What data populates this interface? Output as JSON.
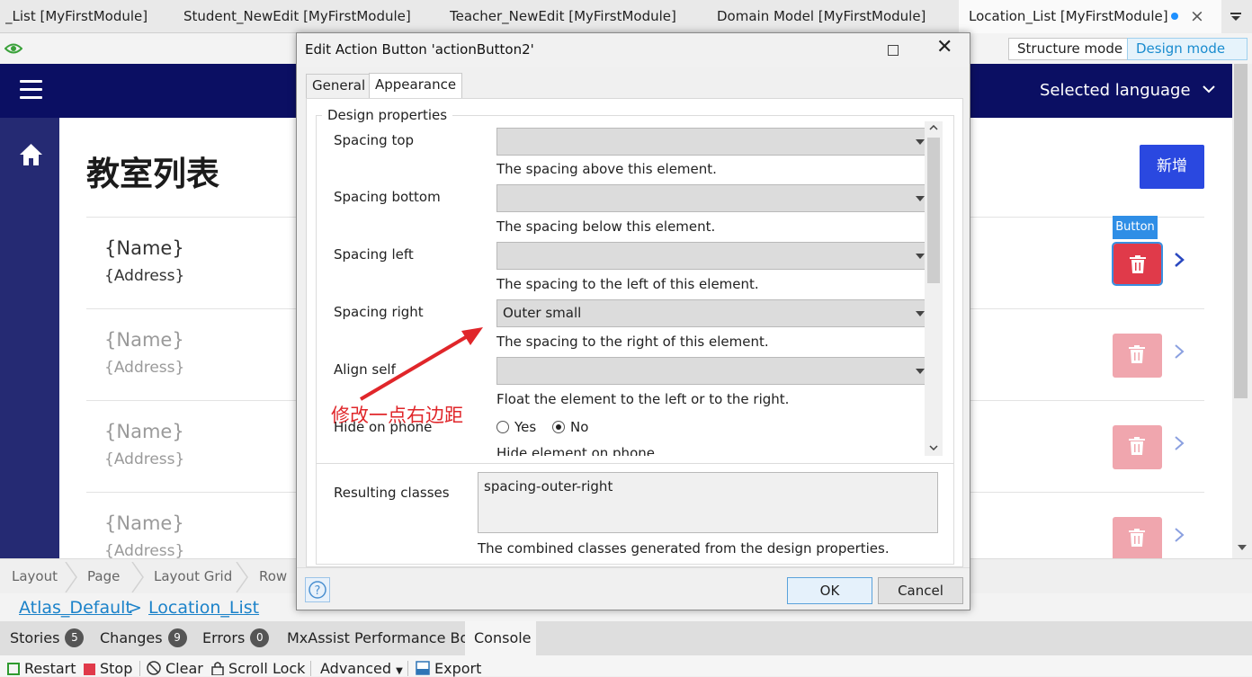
{
  "doc_tabs": [
    {
      "label": "_List [MyFirstModule]"
    },
    {
      "label": "Student_NewEdit [MyFirstModule]"
    },
    {
      "label": "Teacher_NewEdit [MyFirstModule]"
    },
    {
      "label": "Domain Model [MyFirstModule]"
    },
    {
      "label": "Location_List [MyFirstModule]",
      "active": true
    }
  ],
  "toolbar": {
    "structure_mode": "Structure mode",
    "design_mode": "Design mode",
    "active_mode": "Design mode"
  },
  "canvas": {
    "language": "Selected language",
    "page_title": "教室列表",
    "new_button": "新增",
    "button_tag": "Button",
    "rows": [
      {
        "name": "{Name}",
        "address": "{Address}"
      },
      {
        "name": "{Name}",
        "address": "{Address}"
      },
      {
        "name": "{Name}",
        "address": "{Address}"
      },
      {
        "name": "{Name}",
        "address": "{Address}"
      }
    ]
  },
  "breadcrumb": {
    "items": [
      "Layout",
      "Page",
      "Layout Grid",
      "Row"
    ]
  },
  "path": {
    "layout": "Atlas_Default",
    "sep": ">",
    "page": "Location_List"
  },
  "panel_tabs": [
    {
      "label": "Stories",
      "badge": "5"
    },
    {
      "label": "Changes",
      "badge": "9"
    },
    {
      "label": "Errors",
      "badge": "0"
    },
    {
      "label": "MxAssist Performance Bot"
    },
    {
      "label": "Console",
      "active": true
    }
  ],
  "console": {
    "restart": "Restart",
    "stop": "Stop",
    "clear": "Clear",
    "scroll_lock": "Scroll Lock",
    "advanced": "Advanced",
    "export": "Export"
  },
  "dialog": {
    "title": "Edit Action Button 'actionButton2'",
    "tabs": [
      "General",
      "Appearance"
    ],
    "active_tab": "Appearance",
    "group_title": "Design properties",
    "props": [
      {
        "label": "Spacing top",
        "value": "",
        "hint": "The spacing above this element."
      },
      {
        "label": "Spacing bottom",
        "value": "",
        "hint": "The spacing below this element."
      },
      {
        "label": "Spacing left",
        "value": "",
        "hint": "The spacing to the left of this element."
      },
      {
        "label": "Spacing right",
        "value": "Outer small",
        "hint": "The spacing to the right of this element."
      },
      {
        "label": "Align self",
        "value": "",
        "hint": "Float the element to the left or to the right."
      }
    ],
    "hide_on_phone": {
      "label": "Hide on phone",
      "yes": "Yes",
      "no": "No",
      "selected": "No",
      "hint": "Hide element on phone."
    },
    "resulting": {
      "label": "Resulting classes",
      "value": "spacing-outer-right",
      "hint": "The combined classes generated from the design properties."
    },
    "ok": "OK",
    "cancel": "Cancel"
  },
  "annotation": {
    "text": "修改一点右边距",
    "color": "#e0262a"
  }
}
